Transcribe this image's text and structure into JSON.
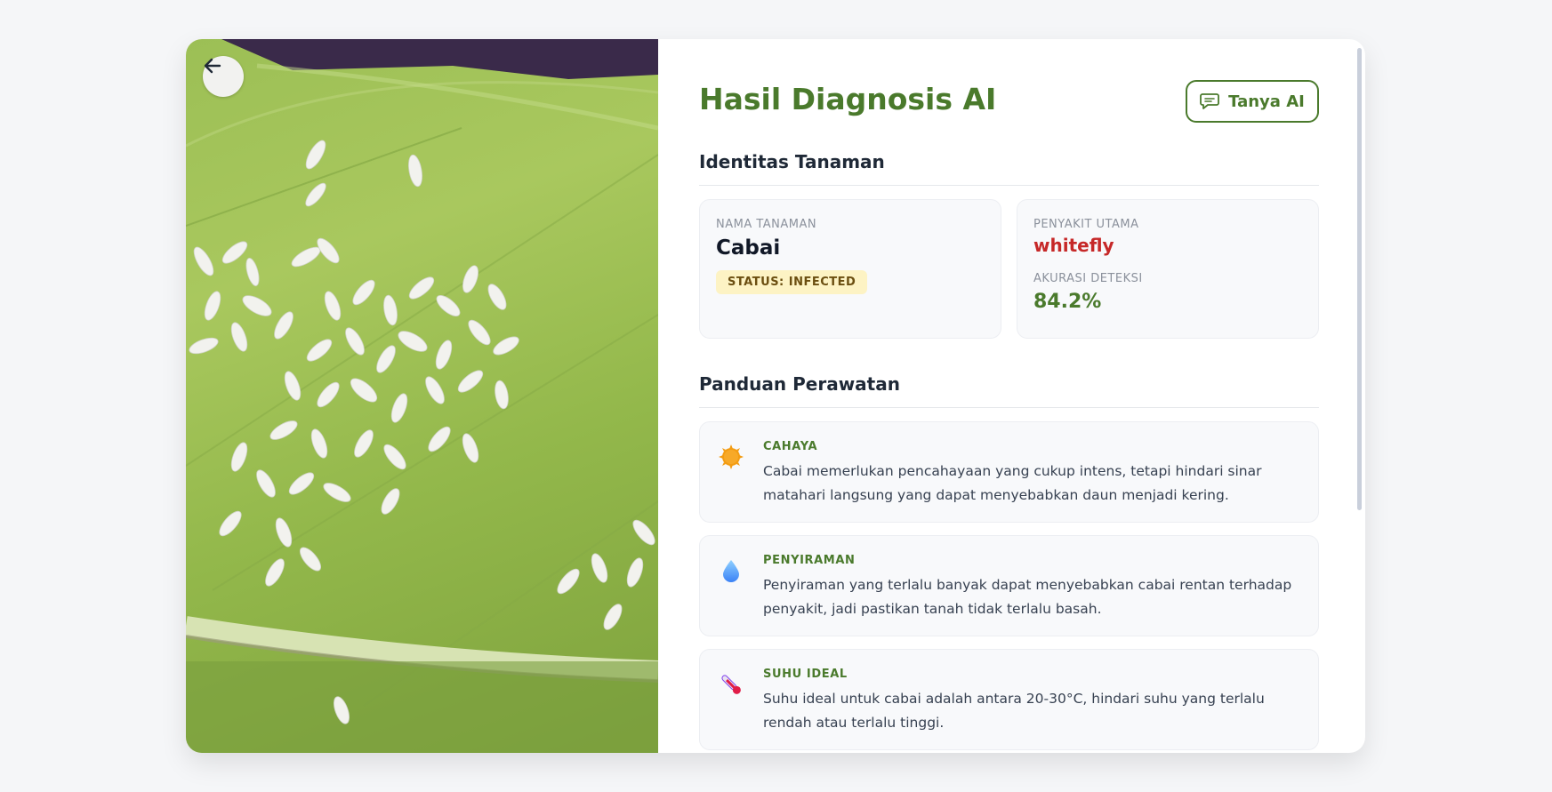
{
  "header": {
    "title": "Hasil Diagnosis AI",
    "ask_ai_label": "Tanya AI"
  },
  "identity": {
    "section_title": "Identitas Tanaman",
    "plant_name_label": "NAMA TANAMAN",
    "plant_name": "Cabai",
    "status_badge": "STATUS: INFECTED",
    "main_disease_label": "PENYAKIT UTAMA",
    "main_disease": "whitefly",
    "accuracy_label": "AKURASI DETEKSI",
    "accuracy": "84.2%"
  },
  "care": {
    "section_title": "Panduan Perawatan",
    "items": [
      {
        "icon": "sun-icon",
        "title": "CAHAYA",
        "text": "Cabai memerlukan pencahayaan yang cukup intens, tetapi hindari sinar matahari langsung yang dapat menyebabkan daun menjadi kering."
      },
      {
        "icon": "water-drop-icon",
        "title": "PENYIRAMAN",
        "text": "Penyiraman yang terlalu banyak dapat menyebabkan cabai rentan terhadap penyakit, jadi pastikan tanah tidak terlalu basah."
      },
      {
        "icon": "thermometer-icon",
        "title": "SUHU IDEAL",
        "text": "Suhu ideal untuk cabai adalah antara 20-30°C, hindari suhu yang terlalu rendah atau terlalu tinggi."
      }
    ]
  },
  "colors": {
    "accent": "#4a7a2c",
    "danger": "#c62828",
    "badge_bg": "#fdf3c4"
  }
}
